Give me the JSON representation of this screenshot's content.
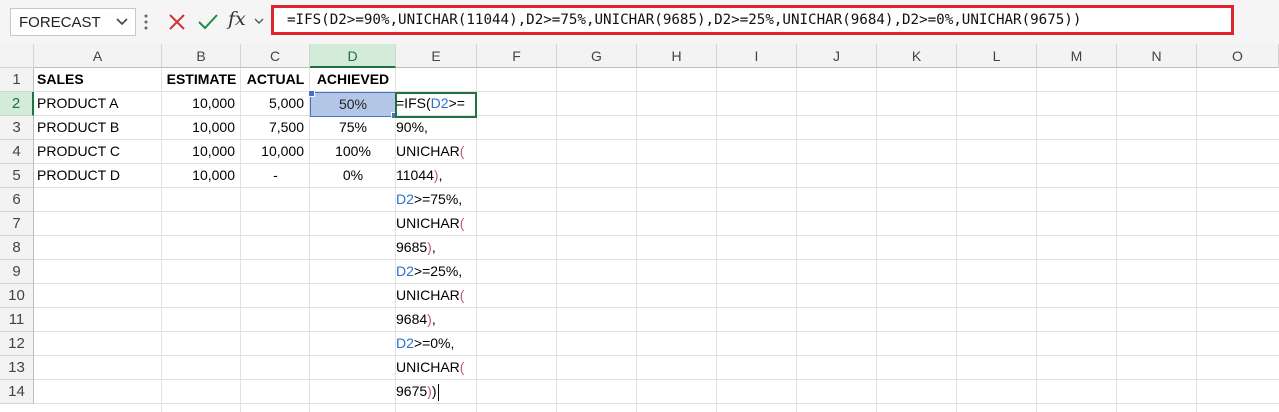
{
  "formula_bar": {
    "name_box": "FORECAST",
    "formula": "=IFS(D2>=90%,UNICHAR(11044),D2>=75%,UNICHAR(9685),D2>=25%,UNICHAR(9684),D2>=0%,UNICHAR(9675))",
    "fx_label": "fx"
  },
  "columns": [
    "A",
    "B",
    "C",
    "D",
    "E",
    "F",
    "G",
    "H",
    "I",
    "J",
    "K",
    "L",
    "M",
    "N",
    "O"
  ],
  "rows": [
    "1",
    "2",
    "3",
    "4",
    "5",
    "6",
    "7",
    "8",
    "9",
    "10",
    "11",
    "12",
    "13",
    "14"
  ],
  "cells": {
    "A1": "SALES",
    "B1": "ESTIMATE",
    "C1": "ACTUAL",
    "D1": "ACHIEVED",
    "A2": "PRODUCT A",
    "B2": "10,000",
    "C2": "5,000",
    "D2": "50%",
    "A3": "PRODUCT B",
    "B3": "10,000",
    "C3": "7,500",
    "D3": "75%",
    "A4": "PRODUCT C",
    "B4": "10,000",
    "C4": "10,000",
    "D4": "100%",
    "A5": "PRODUCT D",
    "B5": "10,000",
    "C5": "-",
    "D5": "0%"
  },
  "edit_cell": {
    "address": "E2",
    "lines": [
      [
        {
          "t": "=IFS(",
          "c": "n"
        },
        {
          "t": "D2",
          "c": "r"
        },
        {
          "t": ">=",
          "c": "n"
        }
      ],
      [
        {
          "t": "90%,",
          "c": "n"
        }
      ],
      [
        {
          "t": "UNICHAR",
          "c": "n"
        },
        {
          "t": "(",
          "c": "p"
        }
      ],
      [
        {
          "t": "11044",
          "c": "n"
        },
        {
          "t": ")",
          "c": "p"
        },
        {
          "t": ",",
          "c": "n"
        }
      ],
      [
        {
          "t": "D2",
          "c": "r"
        },
        {
          "t": ">=75%,",
          "c": "n"
        }
      ],
      [
        {
          "t": "UNICHAR",
          "c": "n"
        },
        {
          "t": "(",
          "c": "p"
        }
      ],
      [
        {
          "t": "9685",
          "c": "n"
        },
        {
          "t": ")",
          "c": "p"
        },
        {
          "t": ",",
          "c": "n"
        }
      ],
      [
        {
          "t": "D2",
          "c": "r"
        },
        {
          "t": ">=25%,",
          "c": "n"
        }
      ],
      [
        {
          "t": "UNICHAR",
          "c": "n"
        },
        {
          "t": "(",
          "c": "p"
        }
      ],
      [
        {
          "t": "9684",
          "c": "n"
        },
        {
          "t": ")",
          "c": "p"
        },
        {
          "t": ",",
          "c": "n"
        }
      ],
      [
        {
          "t": "D2",
          "c": "r"
        },
        {
          "t": ">=0%,",
          "c": "n"
        }
      ],
      [
        {
          "t": "UNICHAR",
          "c": "n"
        },
        {
          "t": "(",
          "c": "p"
        }
      ],
      [
        {
          "t": "9675",
          "c": "n"
        },
        {
          "t": ")",
          "c": "p"
        },
        {
          "t": ")",
          "c": "n"
        }
      ]
    ]
  },
  "colors": {
    "accent_green": "#1f7145",
    "selection_fill": "#b4c6e7",
    "formula_highlight_border": "#e1232d",
    "reference_blue": "#2e6fd0"
  }
}
